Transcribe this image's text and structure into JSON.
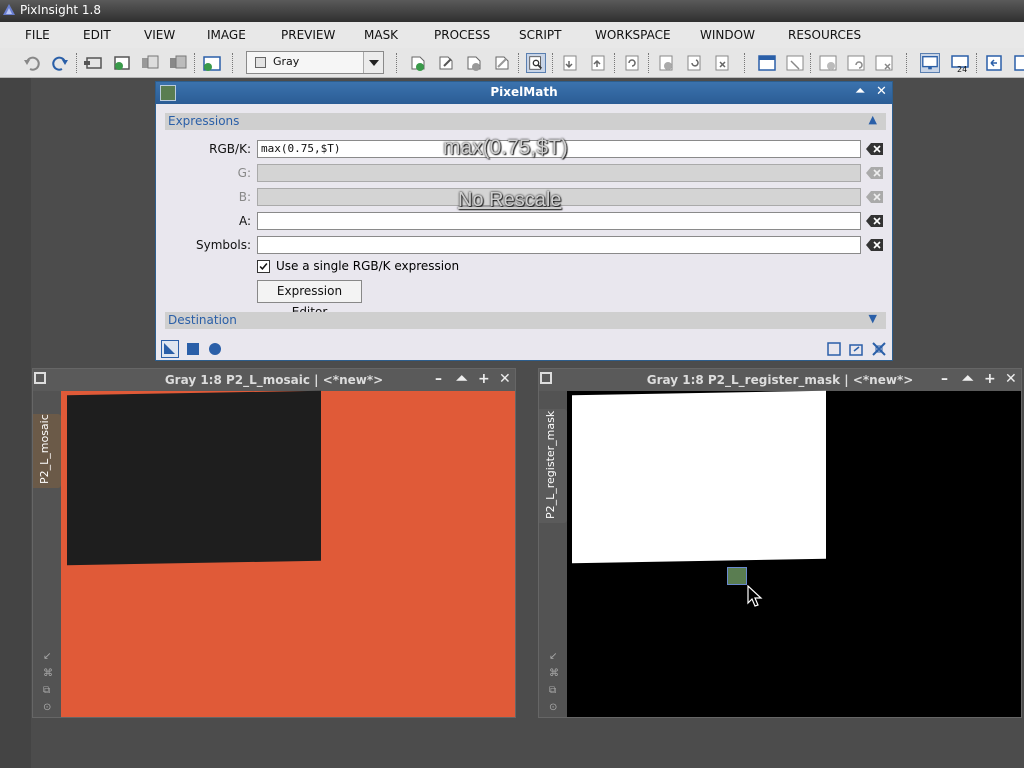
{
  "app": {
    "title": "PixInsight 1.8"
  },
  "menu": [
    "FILE",
    "EDIT",
    "VIEW",
    "IMAGE",
    "PREVIEW",
    "MASK",
    "PROCESS",
    "SCRIPT",
    "WORKSPACE",
    "WINDOW",
    "RESOURCES"
  ],
  "toolbar": {
    "color_space_value": "Gray"
  },
  "pixelmath": {
    "title": "PixelMath",
    "expressions_section": "Expressions",
    "destination_section": "Destination",
    "labels": {
      "rgbk": "RGB/K:",
      "g": "G:",
      "b": "B:",
      "a": "A:",
      "symbols": "Symbols:"
    },
    "rgbk_value": "max(0.75,$T)",
    "g_value": "",
    "b_value": "",
    "a_value": "",
    "symbols_value": "",
    "single_expression_label": "Use a single RGB/K expression",
    "single_expression_checked": true,
    "expression_editor_label": "Expression Editor",
    "overlay_expression": "max(0.75,$T)",
    "overlay_rescale": "No Rescale"
  },
  "windows": [
    {
      "title": "Gray 1:8 P2_L_mosaic | <*new*>",
      "tab": "P2_L_mosaic",
      "background": "#e05a38",
      "content": "#1e1e1e"
    },
    {
      "title": "Gray 1:8 P2_L_register_mask | <*new*>",
      "tab": "P2_L_register_mask",
      "background": "#000000",
      "content": "#ffffff"
    }
  ],
  "colors": {
    "accent": "#2b5c95",
    "section_text": "#2a5fa8"
  }
}
